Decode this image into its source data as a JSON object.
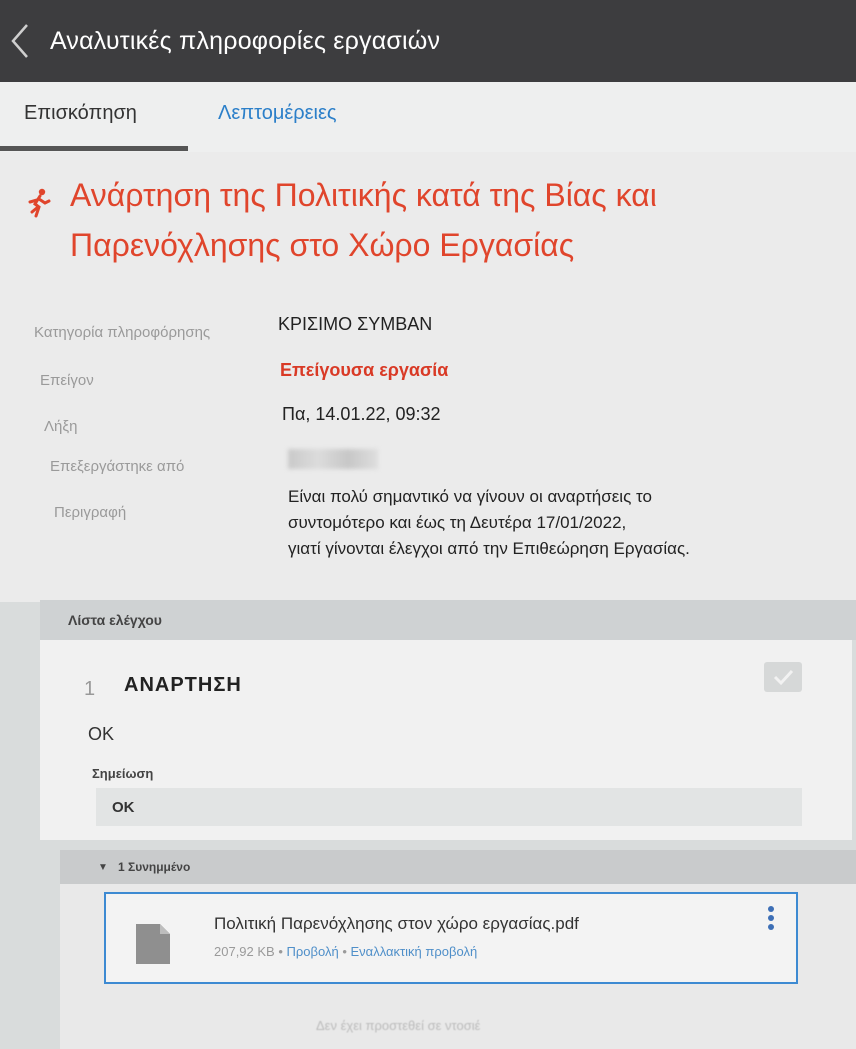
{
  "window": {
    "title": "Αναλυτικές πληροφορίες εργασιών"
  },
  "tabs": [
    {
      "label": "Επισκόπηση"
    },
    {
      "label": "Λεπτομέρειες"
    }
  ],
  "task": {
    "title_line1": "Ανάρτηση της Πολιτικής κατά της Βίας και",
    "title_line2": "Παρενόχλησης στο Χώρο Εργασίας",
    "icon": "running-person-icon",
    "fields": {
      "category_label": "Κατηγορία πληροφόρησης",
      "category_value": "ΚΡΙΣΙΜΟ ΣΥΜΒΑΝ",
      "urgency_label": "Επείγον",
      "urgency_value": "Επείγουσα εργασία",
      "due_label": "Λήξη",
      "due_value": "Πα, 14.01.22, 09:32",
      "processed_label": "Επεξεργάστηκε από",
      "description_label": "Περιγραφή",
      "description_line1": "Είναι πολύ σημαντικό να γίνουν οι αναρτήσεις το",
      "description_line2": "συντομότερο και έως τη Δευτέρα 17/01/2022,",
      "description_line3": "γιατί γίνονται έλεγχοι από την Επιθεώρηση Εργασίας."
    }
  },
  "checklist": {
    "header": "Λίστα ελέγχου",
    "item": {
      "number": "1",
      "title": "ΑΝΑΡΤΗΣΗ",
      "value": "OK",
      "note_label": "Σημείωση",
      "note_value": "OK"
    }
  },
  "attachments": {
    "header": "1 Συνημμένο",
    "file_name": "Πολιτική Παρενόχλησης στον χώρο εργασίας.pdf",
    "file_size": "207,92 KB",
    "view_label": "Προβολή",
    "alt_view_label": "Εναλλακτική προβολή"
  },
  "footer": {
    "text": "Δεν έχει προστεθεί σε ντοσιέ"
  },
  "colors": {
    "accent_red": "#e0452c",
    "link_blue": "#2b7fc9",
    "titlebar": "#3d3d3f"
  }
}
